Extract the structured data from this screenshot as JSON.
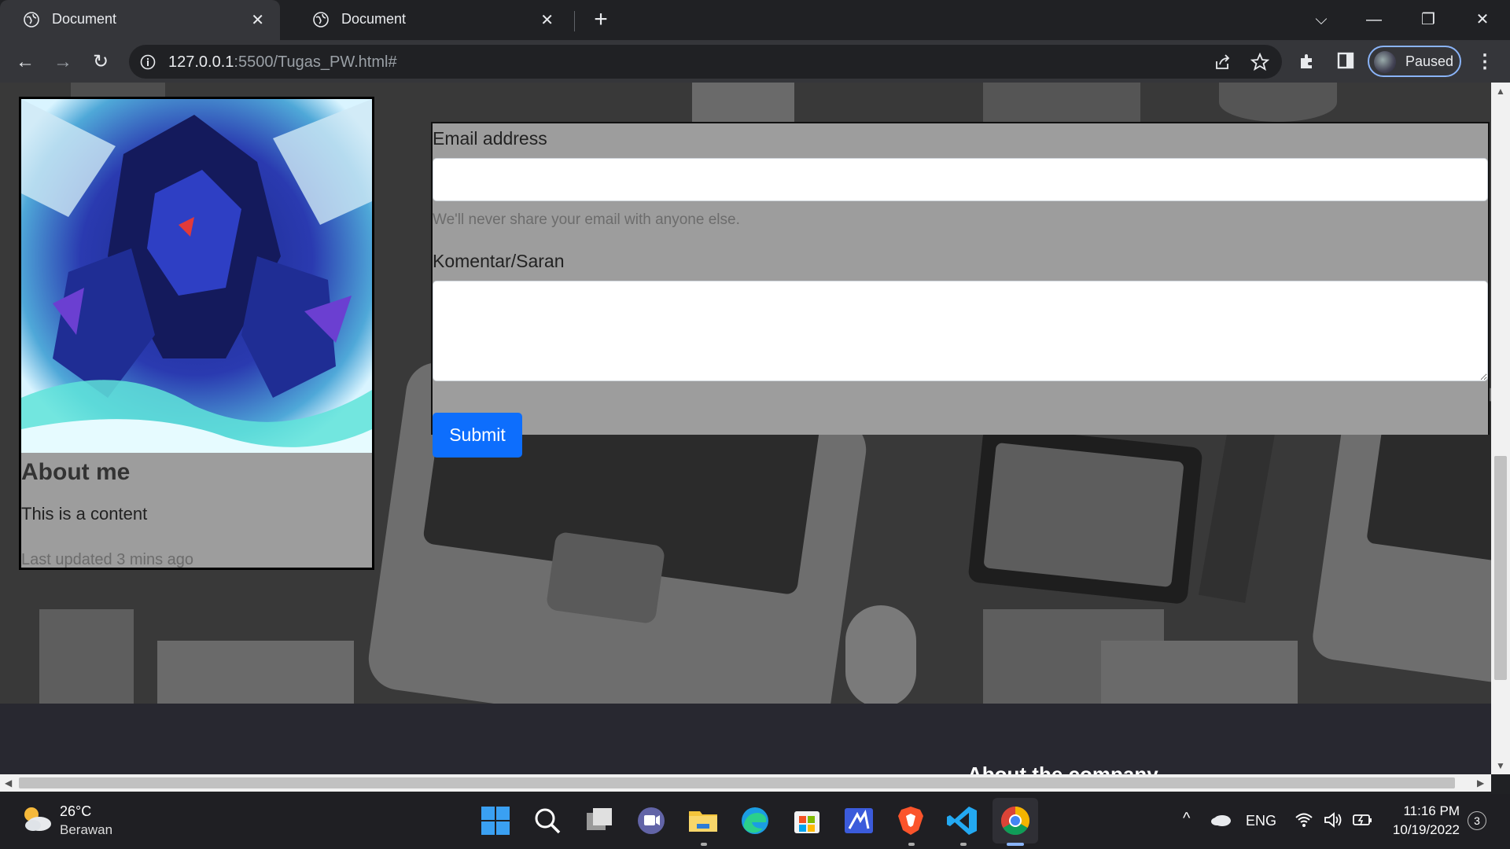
{
  "browser": {
    "tabs": [
      {
        "title": "Document",
        "active": true
      },
      {
        "title": "Document",
        "active": false
      }
    ],
    "url": {
      "host": "127.0.0.1",
      "path": ":5500/Tugas_PW.html#"
    },
    "profile_label": "Paused"
  },
  "card": {
    "title": "About me",
    "text": "This is a content",
    "footer": "Last updated 3 mins ago"
  },
  "form": {
    "email_label": "Email address",
    "email_value": "",
    "email_help": "We'll never share your email with anyone else.",
    "comment_label": "Komentar/Saran",
    "comment_value": "",
    "submit_label": "Submit"
  },
  "footer": {
    "about_title": "About the company"
  },
  "taskbar": {
    "weather_temp": "26°C",
    "weather_cond": "Berawan",
    "lang": "ENG",
    "time": "11:16 PM",
    "date": "10/19/2022",
    "notification_count": "3"
  },
  "colors": {
    "submit": "#0d6efd",
    "chrome_dark": "#202124",
    "chrome_toolbar": "#35363a"
  }
}
